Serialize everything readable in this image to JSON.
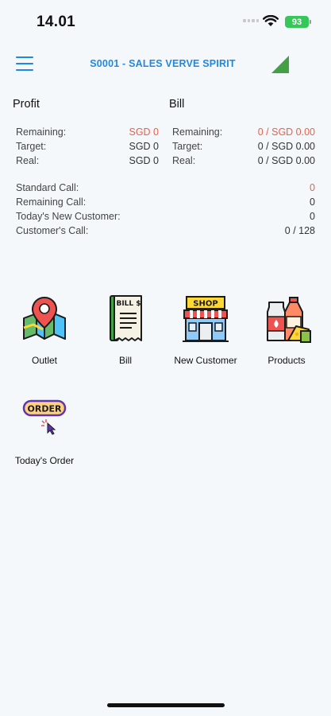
{
  "status_bar": {
    "time": "14.01",
    "battery": "93"
  },
  "app_bar": {
    "title": "S0001 - SALES VERVE SPIRIT"
  },
  "profit": {
    "title": "Profit",
    "rows": [
      {
        "label": "Remaining:",
        "value": "SGD 0",
        "highlight": true
      },
      {
        "label": "Target:",
        "value": "SGD 0",
        "highlight": false
      },
      {
        "label": "Real:",
        "value": "SGD 0",
        "highlight": false
      }
    ]
  },
  "bill": {
    "title": "Bill",
    "rows": [
      {
        "label": "Remaining:",
        "value": "0 / SGD 0.00",
        "highlight": true
      },
      {
        "label": "Target:",
        "value": "0 / SGD 0.00",
        "highlight": false
      },
      {
        "label": "Real:",
        "value": "0 / SGD 0.00",
        "highlight": false
      }
    ]
  },
  "calls": [
    {
      "label": "Standard Call:",
      "value": "0",
      "highlight": true
    },
    {
      "label": "Remaining Call:",
      "value": "0",
      "highlight": false
    },
    {
      "label": "Today's New Customer:",
      "value": "0",
      "highlight": false
    },
    {
      "label": "Customer's Call:",
      "value": "0 / 128",
      "highlight": false
    }
  ],
  "menu": {
    "outlet": {
      "label": "Outlet",
      "icon": "map-pin-icon"
    },
    "bill": {
      "label": "Bill",
      "icon": "bill-receipt-icon",
      "art_text": "BILL $"
    },
    "new_customer": {
      "label": "New Customer",
      "icon": "shop-icon",
      "art_text": "SHOP"
    },
    "products": {
      "label": "Products",
      "icon": "products-icon"
    },
    "todays_order": {
      "label": "Today's Order",
      "icon": "order-icon",
      "art_text": "ORDER"
    }
  },
  "colors": {
    "accent": "#1e88e5",
    "highlight": "#e8604c",
    "background": "#f4f8fa"
  }
}
